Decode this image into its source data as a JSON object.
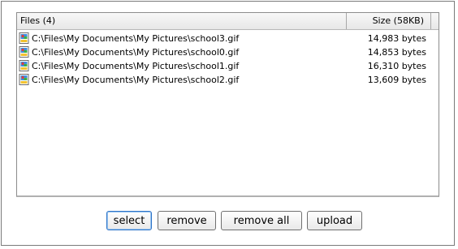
{
  "file_list": {
    "header": {
      "files_label": "Files (4)",
      "size_label": "Size (58KB)"
    },
    "files": [
      {
        "path": "C:\\Files\\My Documents\\My Pictures\\school3.gif",
        "size": "14,983 bytes",
        "icon": "gif-image-icon"
      },
      {
        "path": "C:\\Files\\My Documents\\My Pictures\\school0.gif",
        "size": "14,853 bytes",
        "icon": "gif-image-icon"
      },
      {
        "path": "C:\\Files\\My Documents\\My Pictures\\school1.gif",
        "size": "16,310 bytes",
        "icon": "gif-image-icon"
      },
      {
        "path": "C:\\Files\\My Documents\\My Pictures\\school2.gif",
        "size": "13,609 bytes",
        "icon": "gif-image-icon"
      }
    ]
  },
  "buttons": {
    "select": "select",
    "remove": "remove",
    "remove_all": "remove all",
    "upload": "upload"
  },
  "colors": {
    "focus_border": "#2e74c8",
    "header_bg": "#eeeeee"
  }
}
